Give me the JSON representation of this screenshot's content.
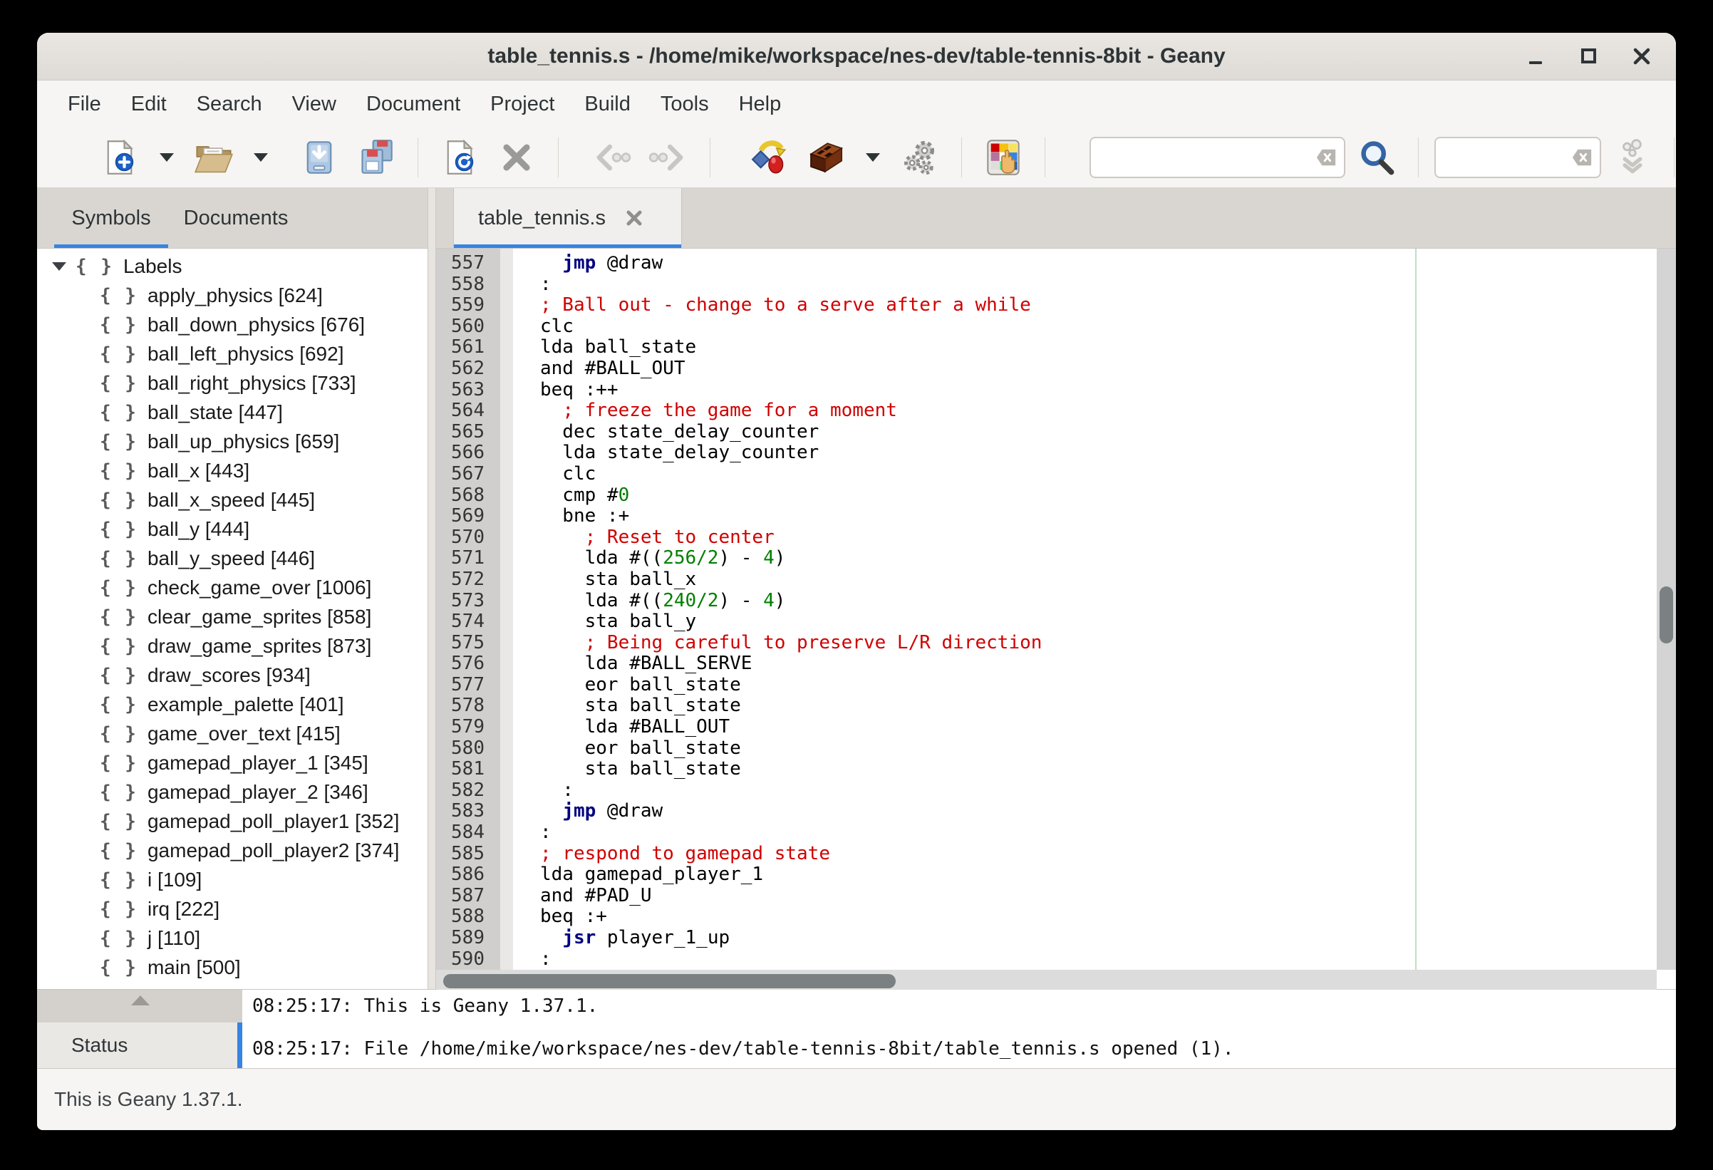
{
  "window": {
    "title": "table_tennis.s - /home/mike/workspace/nes-dev/table-tennis-8bit - Geany",
    "controls": [
      "minimize",
      "maximize",
      "close"
    ]
  },
  "menubar": [
    "File",
    "Edit",
    "Search",
    "View",
    "Document",
    "Project",
    "Build",
    "Tools",
    "Help"
  ],
  "toolbar": {
    "icons": [
      "new-document",
      "new-dropdown",
      "open-folder",
      "open-dropdown",
      "save",
      "save-all",
      "reload",
      "close-document",
      "nav-back",
      "nav-forward",
      "compile",
      "build",
      "build-dropdown",
      "execute",
      "color-chooser",
      "search",
      "jump-to-line",
      "quit"
    ],
    "search_entry": {
      "value": "",
      "placeholder": ""
    },
    "goto_entry": {
      "value": "",
      "placeholder": ""
    }
  },
  "sidebar": {
    "tabs": [
      {
        "label": "Symbols",
        "active": true
      },
      {
        "label": "Documents",
        "active": false
      }
    ],
    "symbols_root": "Labels",
    "symbols": [
      "apply_physics [624]",
      "ball_down_physics [676]",
      "ball_left_physics [692]",
      "ball_right_physics [733]",
      "ball_state [447]",
      "ball_up_physics [659]",
      "ball_x [443]",
      "ball_x_speed [445]",
      "ball_y [444]",
      "ball_y_speed [446]",
      "check_game_over [1006]",
      "clear_game_sprites [858]",
      "draw_game_sprites [873]",
      "draw_scores [934]",
      "example_palette [401]",
      "game_over_text [415]",
      "gamepad_player_1 [345]",
      "gamepad_player_2 [346]",
      "gamepad_poll_player1 [352]",
      "gamepad_poll_player2 [374]",
      "i [109]",
      "irq [222]",
      "j [110]",
      "main [500]"
    ]
  },
  "editor": {
    "tab_label": "table_tennis.s",
    "lines": [
      {
        "num": 557,
        "segs": [
          [
            "  ",
            "d"
          ],
          [
            "jmp",
            "k"
          ],
          [
            " @draw",
            "d"
          ]
        ]
      },
      {
        "num": 558,
        "segs": [
          [
            ":",
            "d"
          ]
        ]
      },
      {
        "num": 559,
        "segs": [
          [
            "; Ball out - change to a serve after a while",
            "c"
          ]
        ]
      },
      {
        "num": 560,
        "segs": [
          [
            "clc",
            "d"
          ]
        ]
      },
      {
        "num": 561,
        "segs": [
          [
            "lda ball_state",
            "d"
          ]
        ]
      },
      {
        "num": 562,
        "segs": [
          [
            "and #BALL_OUT",
            "d"
          ]
        ]
      },
      {
        "num": 563,
        "segs": [
          [
            "beq :++",
            "d"
          ]
        ]
      },
      {
        "num": 564,
        "segs": [
          [
            "  ",
            "d"
          ],
          [
            "; freeze the game for a moment",
            "c"
          ]
        ]
      },
      {
        "num": 565,
        "segs": [
          [
            "  dec state_delay_counter",
            "d"
          ]
        ]
      },
      {
        "num": 566,
        "segs": [
          [
            "  lda state_delay_counter",
            "d"
          ]
        ]
      },
      {
        "num": 567,
        "segs": [
          [
            "  clc",
            "d"
          ]
        ]
      },
      {
        "num": 568,
        "segs": [
          [
            "  cmp #",
            "d"
          ],
          [
            "0",
            "n"
          ]
        ]
      },
      {
        "num": 569,
        "segs": [
          [
            "  bne :+",
            "d"
          ]
        ]
      },
      {
        "num": 570,
        "segs": [
          [
            "    ",
            "d"
          ],
          [
            "; Reset to center",
            "c"
          ]
        ]
      },
      {
        "num": 571,
        "segs": [
          [
            "    lda #((",
            "d"
          ],
          [
            "256/2",
            "n"
          ],
          [
            ") - ",
            "d"
          ],
          [
            "4",
            "n"
          ],
          [
            ")",
            "d"
          ]
        ]
      },
      {
        "num": 572,
        "segs": [
          [
            "    sta ball_x",
            "d"
          ]
        ]
      },
      {
        "num": 573,
        "segs": [
          [
            "    lda #((",
            "d"
          ],
          [
            "240/2",
            "n"
          ],
          [
            ") - ",
            "d"
          ],
          [
            "4",
            "n"
          ],
          [
            ")",
            "d"
          ]
        ]
      },
      {
        "num": 574,
        "segs": [
          [
            "    sta ball_y",
            "d"
          ]
        ]
      },
      {
        "num": 575,
        "segs": [
          [
            "    ",
            "d"
          ],
          [
            "; Being careful to preserve L/R direction",
            "c"
          ]
        ]
      },
      {
        "num": 576,
        "segs": [
          [
            "    lda #BALL_SERVE",
            "d"
          ]
        ]
      },
      {
        "num": 577,
        "segs": [
          [
            "    eor ball_state",
            "d"
          ]
        ]
      },
      {
        "num": 578,
        "segs": [
          [
            "    sta ball_state",
            "d"
          ]
        ]
      },
      {
        "num": 579,
        "segs": [
          [
            "    lda #BALL_OUT",
            "d"
          ]
        ]
      },
      {
        "num": 580,
        "segs": [
          [
            "    eor ball_state",
            "d"
          ]
        ]
      },
      {
        "num": 581,
        "segs": [
          [
            "    sta ball_state",
            "d"
          ]
        ]
      },
      {
        "num": 582,
        "segs": [
          [
            "  :",
            "d"
          ]
        ]
      },
      {
        "num": 583,
        "segs": [
          [
            "  ",
            "d"
          ],
          [
            "jmp",
            "k"
          ],
          [
            " @draw",
            "d"
          ]
        ]
      },
      {
        "num": 584,
        "segs": [
          [
            ":",
            "d"
          ]
        ]
      },
      {
        "num": 585,
        "segs": [
          [
            "; respond to gamepad state",
            "c"
          ]
        ]
      },
      {
        "num": 586,
        "segs": [
          [
            "lda gamepad_player_1",
            "d"
          ]
        ]
      },
      {
        "num": 587,
        "segs": [
          [
            "and #PAD_U",
            "d"
          ]
        ]
      },
      {
        "num": 588,
        "segs": [
          [
            "beq :+",
            "d"
          ]
        ]
      },
      {
        "num": 589,
        "segs": [
          [
            "  ",
            "d"
          ],
          [
            "jsr",
            "k"
          ],
          [
            " player_1_up",
            "d"
          ]
        ]
      },
      {
        "num": 590,
        "segs": [
          [
            ":",
            "d"
          ]
        ]
      }
    ]
  },
  "messages": {
    "tab_label": "Status",
    "lines": [
      "08:25:17: This is Geany 1.37.1.",
      "08:25:17: File /home/mike/workspace/nes-dev/table-tennis-8bit/table_tennis.s opened (1)."
    ]
  },
  "statusbar": {
    "text": "This is Geany 1.37.1."
  },
  "colors": {
    "accent": "#3584e4",
    "comment": "#d00000",
    "keyword": "#000080",
    "number": "#007f00",
    "long_line_marker": "#bfe0bf"
  }
}
